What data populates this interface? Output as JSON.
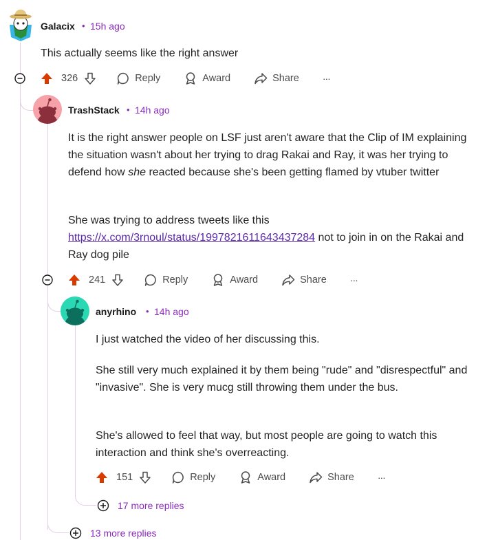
{
  "comments": [
    {
      "username": "Galacix",
      "separator": "•",
      "time": "15h ago",
      "paragraphs": [
        "This actually seems like the right answer"
      ],
      "votes": "326"
    },
    {
      "username": "TrashStack",
      "separator": "•",
      "time": "14h ago",
      "paragraphs": [
        "It is the right answer people on LSF just aren't aware that the Clip of IM explaining the situation wasn't about her trying to drag Rakai and Ray, it was her trying to defend how",
        "she",
        "reacted because she's been getting flamed by vtuber twitter",
        "She was trying to address tweets like this",
        "https://x.com/3rnoul/status/1997821611643437284",
        "not to join in on the Rakai and Ray dog pile"
      ],
      "votes": "241"
    },
    {
      "username": "anyrhino",
      "separator": "•",
      "time": "14h ago",
      "paragraphs": [
        "I just watched the video of her discussing this.",
        "She still very much explained it by them being \"rude\" and \"disrespectful\" and \"invasive\". She is very mucg still throwing them under the bus.",
        "She's allowed to feel that way, but most people are going to watch this interaction and think she's overreacting."
      ],
      "votes": "151"
    }
  ],
  "actions": {
    "reply": "Reply",
    "award": "Award",
    "share": "Share",
    "more": "···"
  },
  "more_replies": {
    "inner": "17 more replies",
    "outer": "13 more replies"
  },
  "colors": {
    "upvote": "#d93a00",
    "time": "#8a2bbd",
    "thread": "#e3cce6",
    "link": "#5b2aa8",
    "avatar_trashstack": "#f7a1a9",
    "avatar_anyrhino": "#2ad8b4"
  },
  "icons": [
    "collapse-icon",
    "upvote-icon",
    "downvote-icon",
    "reply-icon",
    "award-icon",
    "share-icon",
    "more-options-icon",
    "expand-icon"
  ]
}
